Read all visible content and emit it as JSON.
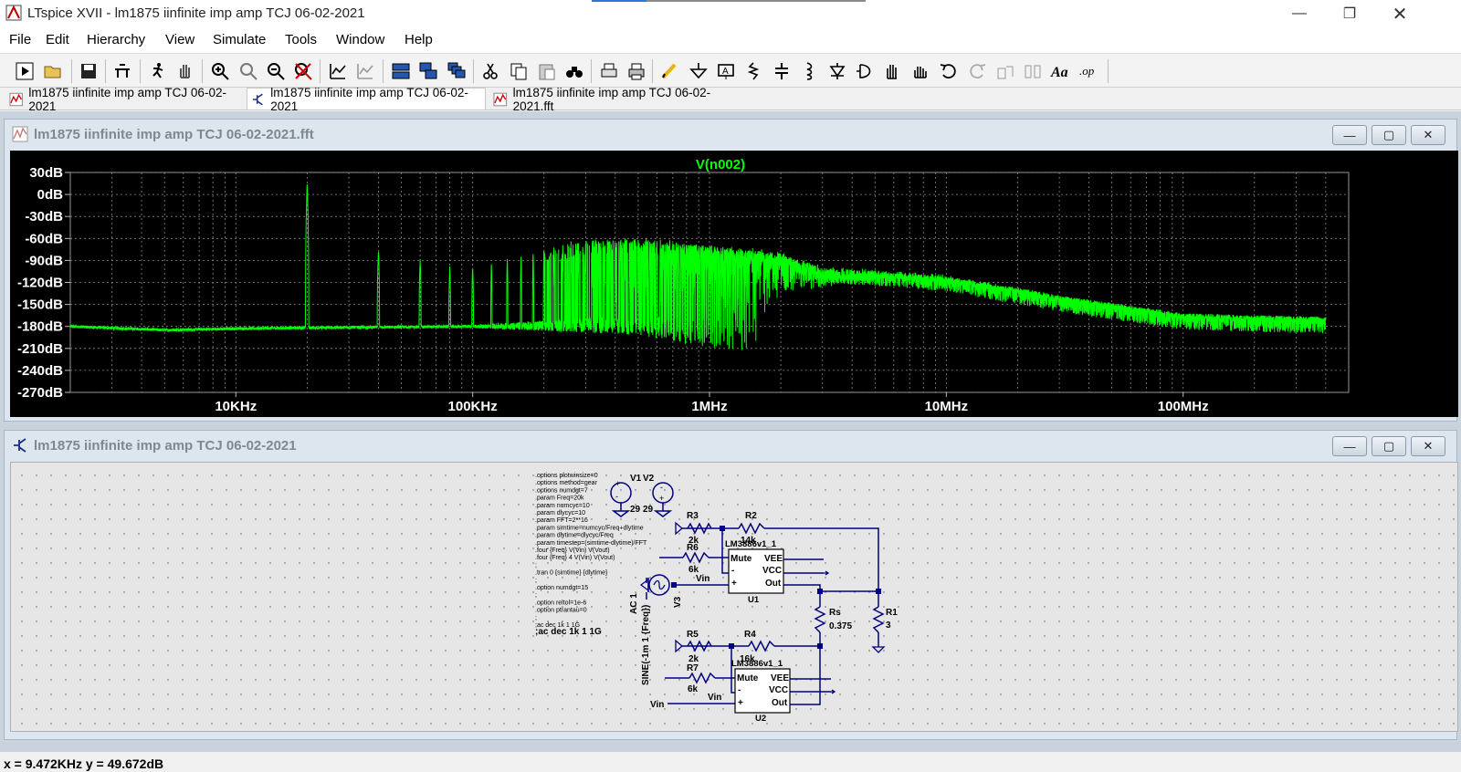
{
  "window": {
    "title": "LTspice XVII - lm1875 iinfinite imp amp TCJ 06-02-2021",
    "minimize": "—",
    "restore": "❐",
    "close": "✕"
  },
  "menu": [
    "File",
    "Edit",
    "Hierarchy",
    "View",
    "Simulate",
    "Tools",
    "Window",
    "Help"
  ],
  "toolbar_icons": [
    "run-icon",
    "open-icon",
    "save-icon",
    "control-panel-icon",
    "halt-icon",
    "pan-icon",
    "zoom-in-icon",
    "zoom-area-icon",
    "zoom-out-icon",
    "zoom-cancel-icon",
    "autorange-icon",
    "manual-limits-icon",
    "tile-horizontal-icon",
    "tile-vertical-icon",
    "cascade-icon",
    "cut-icon",
    "copy-icon",
    "paste-icon",
    "find-icon",
    "print-preview-icon",
    "print-icon",
    "draw-wire-icon",
    "ground-icon",
    "label-net-icon",
    "resistor-icon",
    "capacitor-icon",
    "inductor-icon",
    "diode-icon",
    "component-icon",
    "move-icon",
    "drag-icon",
    "undo-icon",
    "redo-icon",
    "rotate-icon",
    "mirror-icon",
    "text-icon",
    "spice-directive-icon"
  ],
  "tabs": [
    {
      "label": "lm1875 iinfinite imp amp TCJ 06-02-2021",
      "icon": "waveform-icon",
      "active": false
    },
    {
      "label": "lm1875 iinfinite imp amp TCJ 06-02-2021",
      "icon": "schematic-icon",
      "active": true
    },
    {
      "label": "lm1875 iinfinite imp amp TCJ 06-02-2021.fft",
      "icon": "waveform-icon",
      "active": false
    }
  ],
  "fft_window": {
    "title": "lm1875 iinfinite imp amp TCJ 06-02-2021.fft",
    "btn_min": "—",
    "btn_max": "▢",
    "btn_close": "✕"
  },
  "schematic_window": {
    "title": "lm1875 iinfinite imp amp TCJ 06-02-2021",
    "btn_min": "—",
    "btn_max": "▢",
    "btn_close": "✕"
  },
  "chart_data": {
    "type": "line",
    "title": "V(n002)",
    "series": [
      {
        "name": "V(n002)",
        "color": "#00ff00"
      }
    ],
    "x_scale": "log",
    "x_ticks": [
      "10KHz",
      "100KHz",
      "1MHz",
      "10MHz",
      "100MHz"
    ],
    "x_tick_values": [
      10000,
      100000,
      1000000,
      10000000,
      100000000
    ],
    "xlim": [
      2000,
      500000000
    ],
    "ylim": [
      -270,
      30
    ],
    "y_ticks": [
      "30dB",
      "0dB",
      "-30dB",
      "-60dB",
      "-90dB",
      "-120dB",
      "-150dB",
      "-180dB",
      "-210dB",
      "-240dB",
      "-270dB"
    ],
    "y_tick_values": [
      30,
      0,
      -30,
      -60,
      -90,
      -120,
      -150,
      -180,
      -210,
      -240,
      -270
    ],
    "grid": true,
    "fundamental_hz": 20000,
    "fundamental_peak_db": 15,
    "harmonic_peaks": [
      {
        "x": 40000,
        "y": -78
      },
      {
        "x": 60000,
        "y": -90
      },
      {
        "x": 80000,
        "y": -100
      },
      {
        "x": 100000,
        "y": -98
      },
      {
        "x": 200000,
        "y": -75
      },
      {
        "x": 300000,
        "y": -62
      },
      {
        "x": 500000,
        "y": -60
      },
      {
        "x": 1000000,
        "y": -70
      },
      {
        "x": 2000000,
        "y": -80
      },
      {
        "x": 3000000,
        "y": -100
      },
      {
        "x": 10000000,
        "y": -112
      },
      {
        "x": 30000000,
        "y": -140
      },
      {
        "x": 100000000,
        "y": -165
      },
      {
        "x": 400000000,
        "y": -170
      }
    ],
    "noise_floor": [
      {
        "x": 2000,
        "y": -180
      },
      {
        "x": 5000,
        "y": -185
      },
      {
        "x": 10000,
        "y": -183
      },
      {
        "x": 18000,
        "y": -182
      },
      {
        "x": 100000,
        "y": -180
      },
      {
        "x": 500000,
        "y": -178
      },
      {
        "x": 1000000,
        "y": -190
      },
      {
        "x": 3000000,
        "y": -195
      },
      {
        "x": 10000000,
        "y": -200
      },
      {
        "x": 100000000,
        "y": -215
      },
      {
        "x": 400000000,
        "y": -240
      }
    ]
  },
  "schematic": {
    "directives": [
      ".options plotwinsize=0",
      ".options method=gear",
      ".options numdgt=7",
      ".param Freq=20k",
      ".param numcyc=10",
      ".param dlycyc=10",
      ".param FFT=2**16",
      ".param simtime=numcyc/Freq+dlytime",
      ".param dlytime=dlycyc/Freq",
      ".param timestep=(simtime-dlytime)/FFT",
      ".four {Freq} V(Vin) V(Vout)",
      ".four {Freq} 4 V(Vin) V(Vout)",
      ";",
      ".tran 0 {simtime} {dlytime}",
      ";",
      ".option numdgt=15",
      ";",
      ".option reltol=1e-6",
      ".option ptrantau=0",
      ";",
      ";ac dec 1k 1 1G",
      ";ac dec 1k 1 1G"
    ],
    "v1": "V1",
    "v2": "V2",
    "v1_val": "29",
    "v2_val": "29",
    "r3": "R3",
    "r3_val": "2k",
    "r2": "R2",
    "r2_val": "14k",
    "r6": "R6",
    "r6_val": "6k",
    "r5": "R5",
    "r5_val": "2k",
    "r4": "R4",
    "r4_val": "16k",
    "r7": "R7",
    "r7_val": "6k",
    "rs": "Rs",
    "rs_val": "0.375",
    "r1": "R1",
    "r1_val": "3",
    "u1": "U1",
    "u2": "U2",
    "ic_label": "LM3886v1_1",
    "pin_mute": "Mute",
    "pin_minus": "-",
    "pin_plus": "+",
    "pin_vee": "VEE",
    "pin_vcc": "VCC",
    "pin_out": "Out",
    "vin": "Vin",
    "v3": "V3",
    "ac": "AC 1",
    "sine": "SINE(-1m 1 {Freq})"
  },
  "status": "x = 9.472KHz    y = 49.672dB"
}
